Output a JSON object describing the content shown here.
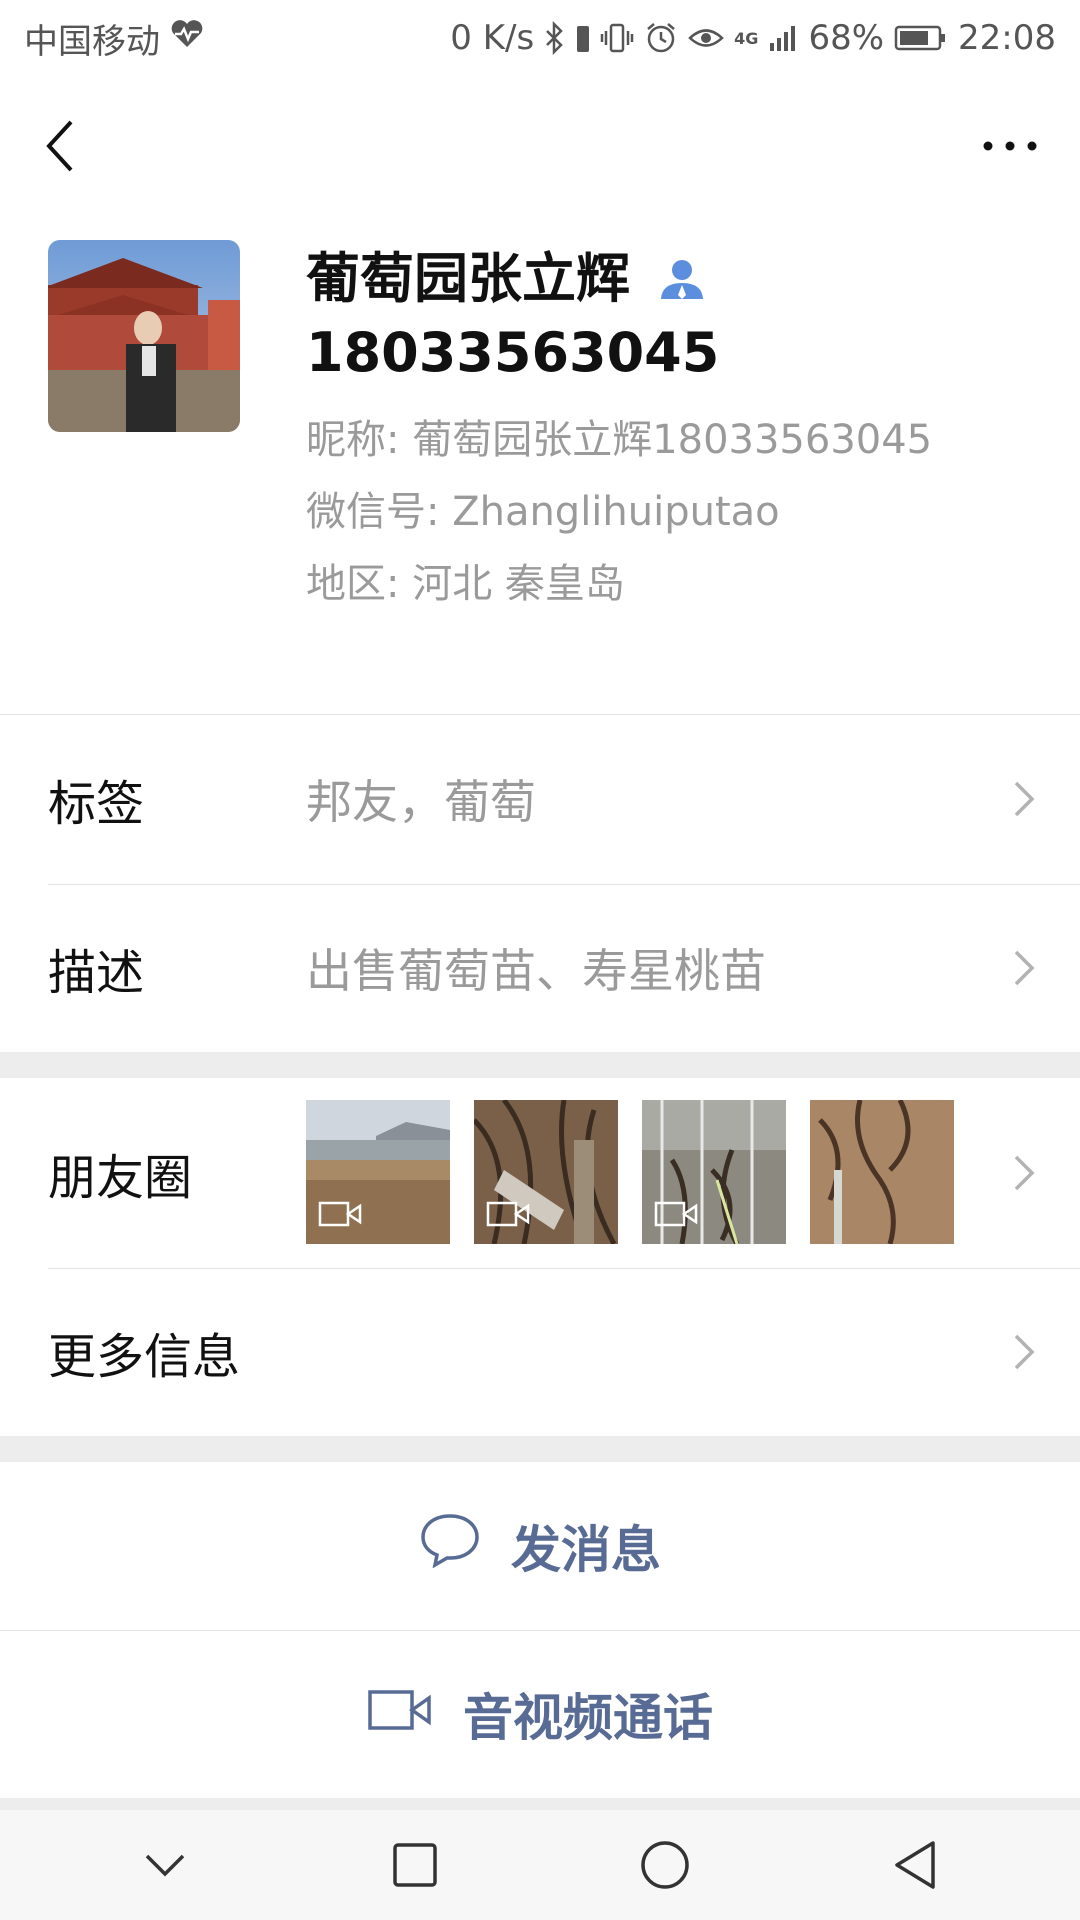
{
  "status_bar": {
    "carrier": "中国移动",
    "speed": "0 K/s",
    "network": "4G",
    "battery": "68%",
    "time": "22:08"
  },
  "profile": {
    "name": "葡萄园张立辉",
    "phone": "18033563045",
    "nickname": "昵称:  葡萄园张立辉18033563045",
    "wechat_id": "微信号:  Zhanglihuiputao",
    "region": "地区:  河北  秦皇岛"
  },
  "rows": {
    "tags": {
      "label": "标签",
      "value": "邦友，葡萄"
    },
    "description": {
      "label": "描述",
      "value": "出售葡萄苗、寿星桃苗"
    },
    "moments": {
      "label": "朋友圈"
    },
    "more_info": {
      "label": "更多信息"
    }
  },
  "actions": {
    "message": "发消息",
    "call": "音视频通话"
  },
  "colors": {
    "link": "#576b95",
    "secondary_text": "#9a9a9a",
    "person_icon": "#5b8fdd"
  },
  "icons": [
    "back-arrow-icon",
    "more-dots-icon",
    "person-icon",
    "chevron-right-icon",
    "video-icon",
    "chat-bubble-icon",
    "video-call-icon"
  ]
}
